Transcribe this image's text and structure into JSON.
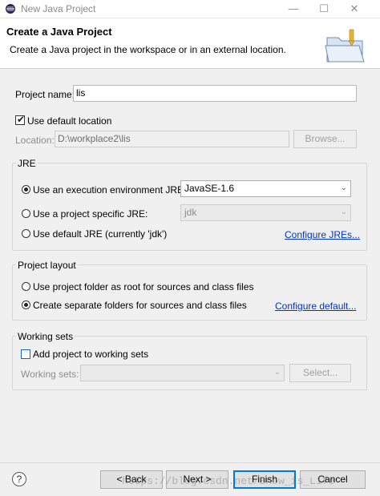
{
  "window": {
    "title": "New Java Project",
    "minimize_glyph": "—",
    "maximize_glyph": "☐",
    "close_glyph": "✕"
  },
  "header": {
    "title": "Create a Java Project",
    "subtitle": "Create a Java project in the workspace or in an external location.",
    "icon": "new-java-project-folder-icon"
  },
  "project_name": {
    "label": "Project name:",
    "value": "lis"
  },
  "default_location": {
    "checkbox_label": "Use default location",
    "checked": true,
    "location_label": "Location:",
    "location_value": "D:\\workplace2\\lis",
    "browse_label": "Browse..."
  },
  "jre": {
    "title": "JRE",
    "options": {
      "exec_env": "Use an execution environment JRE:",
      "specific": "Use a project specific JRE:",
      "default": "Use default JRE (currently 'jdk')"
    },
    "selected": "exec_env",
    "exec_env_value": "JavaSE-1.6",
    "specific_value": "jdk",
    "configure_link": "Configure JREs..."
  },
  "project_layout": {
    "title": "Project layout",
    "options": {
      "root": "Use project folder as root for sources and class files",
      "separate": "Create separate folders for sources and class files"
    },
    "selected": "separate",
    "configure_link": "Configure default..."
  },
  "working_sets": {
    "title": "Working sets",
    "checkbox_label": "Add project to working sets",
    "checked": false,
    "field_label": "Working sets:",
    "field_value": "",
    "select_label": "Select..."
  },
  "footer": {
    "help_glyph": "?",
    "back_label": "< Back",
    "next_label": "Next >",
    "finish_label": "Finish",
    "cancel_label": "Cancel"
  },
  "watermark": "https://blog.csdn.net/Snow_is_Life"
}
